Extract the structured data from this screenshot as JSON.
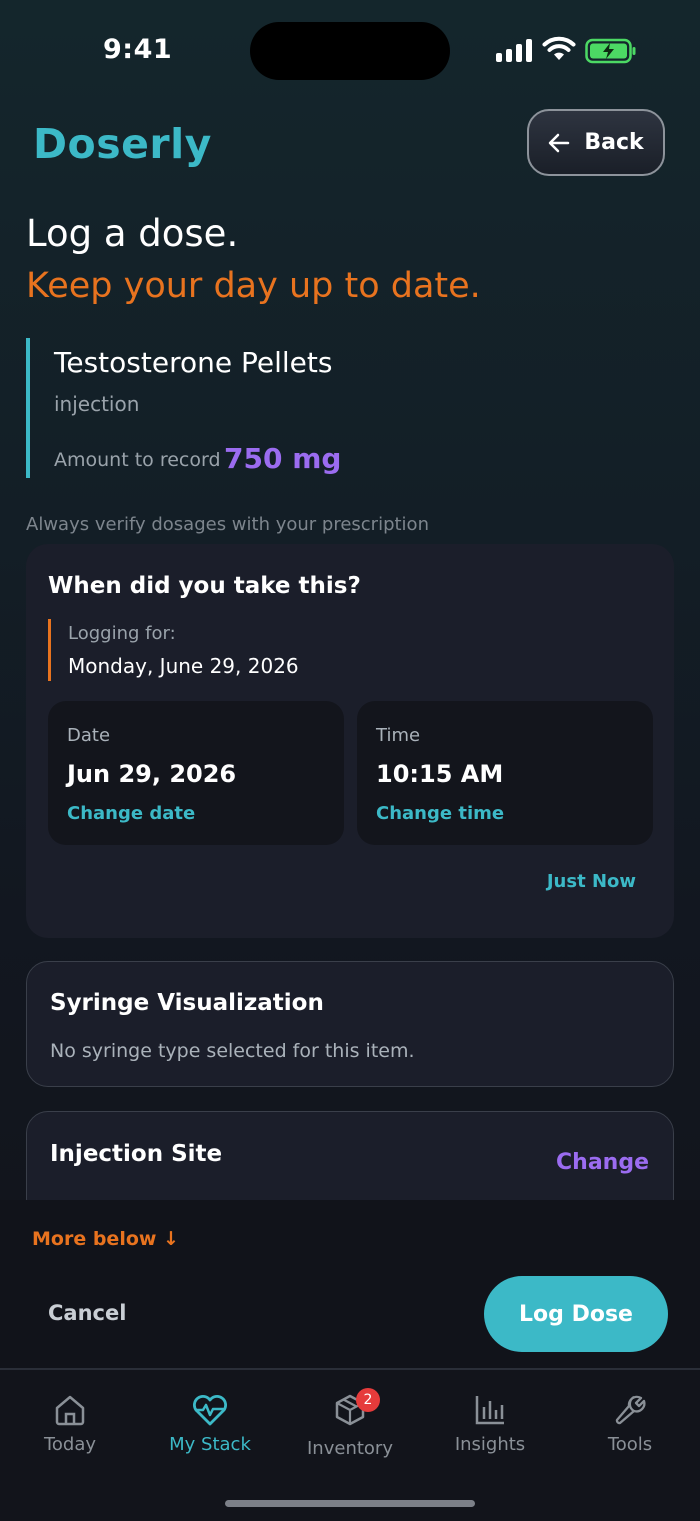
{
  "status_bar": {
    "time": "9:41"
  },
  "app": {
    "name": "Doserly",
    "back_label": "Back"
  },
  "header": {
    "title": "Log a dose.",
    "subtitle": "Keep your day up to date."
  },
  "medication": {
    "name": "Testosterone Pellets",
    "type": "injection",
    "amount_label": "Amount to record",
    "amount_value": "750 mg"
  },
  "disclaimer": "Always verify dosages with your prescription",
  "when_card": {
    "title": "When did you take this?",
    "logging_label": "Logging for:",
    "logging_date": "Monday, June 29, 2026",
    "date": {
      "label": "Date",
      "value": "Jun 29, 2026",
      "change": "Change date"
    },
    "time": {
      "label": "Time",
      "value": "10:15 AM",
      "change": "Change time"
    },
    "just_now": "Just Now"
  },
  "syringe_card": {
    "title": "Syringe Visualization",
    "text": "No syringe type selected for this item."
  },
  "injection_card": {
    "title": "Injection Site",
    "change": "Change"
  },
  "footer": {
    "more_below": "More below ↓",
    "cancel": "Cancel",
    "log_dose": "Log Dose"
  },
  "tabs": [
    {
      "label": "Today",
      "icon": "home-icon"
    },
    {
      "label": "My Stack",
      "icon": "heart-pulse-icon",
      "active": true
    },
    {
      "label": "Inventory",
      "icon": "box-icon",
      "badge": "2"
    },
    {
      "label": "Insights",
      "icon": "bar-chart-icon"
    },
    {
      "label": "Tools",
      "icon": "wrench-icon"
    }
  ],
  "colors": {
    "accent": "#3cb9c7",
    "orange": "#e8731f",
    "purple": "#9b6cf0",
    "badge": "#e63b3b"
  }
}
